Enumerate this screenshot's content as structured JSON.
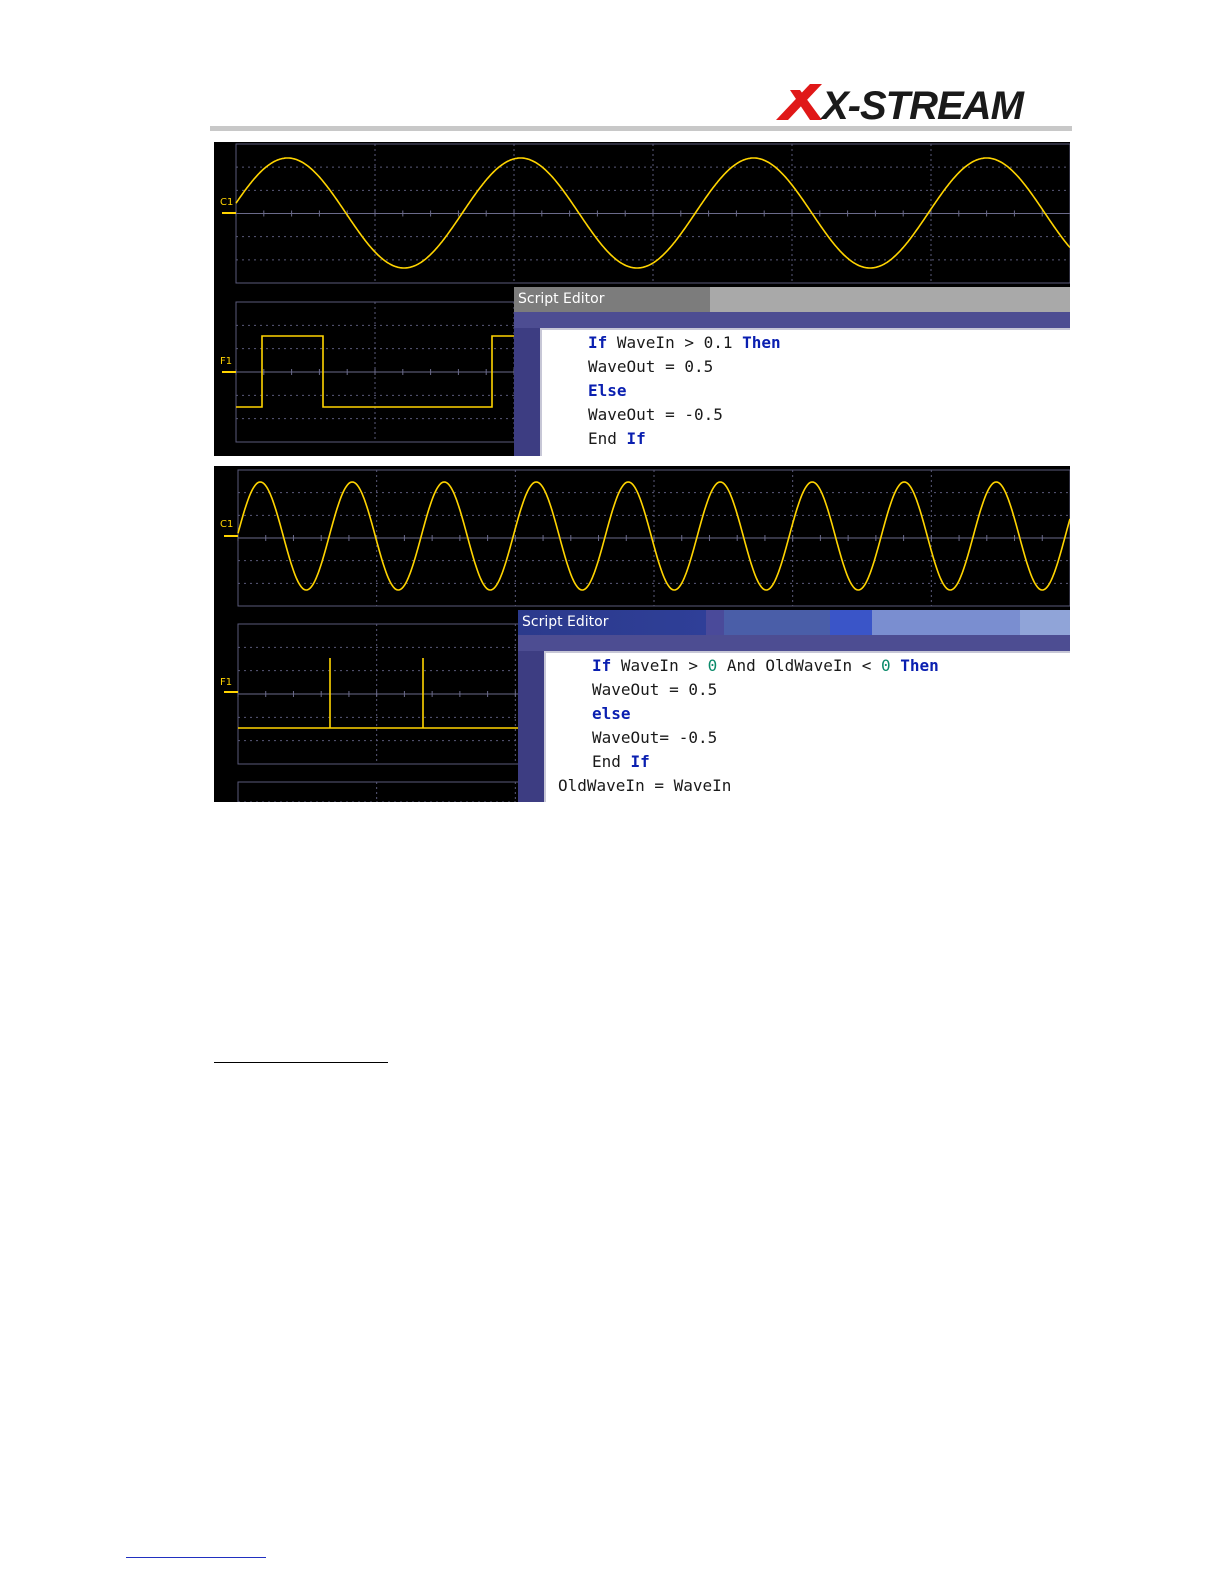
{
  "logo": {
    "text": "X-STREAM"
  },
  "screenshot_top": {
    "upper_trace_label": "C1",
    "lower_trace_label": "F1",
    "editor": {
      "title": "Script Editor",
      "lines": [
        [
          {
            "t": "If",
            "k": "kw"
          },
          {
            "t": " WaveIn > 0.1 "
          },
          {
            "t": "Then",
            "k": "kw"
          }
        ],
        [
          {
            "t": "WaveOut = 0.5"
          }
        ],
        [
          {
            "t": "Else",
            "k": "kw"
          }
        ],
        [
          {
            "t": "WaveOut = -0.5"
          }
        ],
        [
          {
            "t": "End "
          },
          {
            "t": "If",
            "k": "kw"
          }
        ]
      ]
    }
  },
  "screenshot_bottom": {
    "upper_trace_label": "C1",
    "lower_trace_label": "F1",
    "editor": {
      "title": "Script Editor",
      "lines": [
        [
          {
            "t": "If",
            "k": "kw"
          },
          {
            "t": " WaveIn > "
          },
          {
            "t": "0",
            "k": "num"
          },
          {
            "t": " And OldWaveIn < "
          },
          {
            "t": "0",
            "k": "num"
          },
          {
            "t": " "
          },
          {
            "t": "Then",
            "k": "kw"
          }
        ],
        [
          {
            "t": "WaveOut = 0.5"
          }
        ],
        [
          {
            "t": "else",
            "k": "kw"
          }
        ],
        [
          {
            "t": "WaveOut= -0.5"
          }
        ],
        [
          {
            "t": "End "
          },
          {
            "t": "If",
            "k": "kw"
          }
        ],
        [
          {
            "t": "OldWaveIn = WaveIn"
          }
        ]
      ]
    }
  },
  "colors": {
    "trace": "#ffd400",
    "grid": "#5a5a7a",
    "keyword": "#0a1fb0",
    "number": "#0a8a6a"
  }
}
